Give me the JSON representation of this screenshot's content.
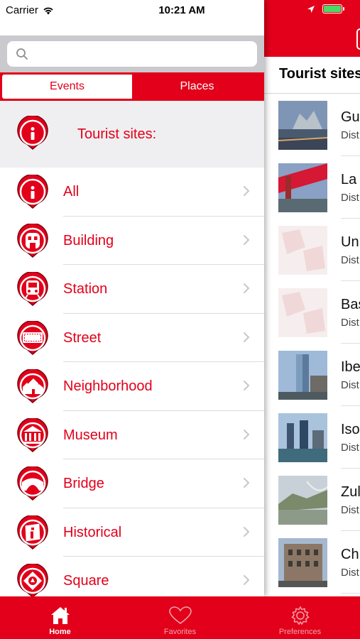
{
  "status_bar": {
    "carrier": "Carrier",
    "time": "10:21 AM"
  },
  "search": {
    "placeholder": "",
    "value": ""
  },
  "segments": [
    {
      "label": "Events",
      "selected": false
    },
    {
      "label": "Places",
      "selected": true
    }
  ],
  "section_header": {
    "title": "Tourist sites:",
    "icon": "info-pin-icon"
  },
  "categories": [
    {
      "label": "All",
      "icon": "info-pin-icon"
    },
    {
      "label": "Building",
      "icon": "building-pin-icon"
    },
    {
      "label": "Station",
      "icon": "train-pin-icon"
    },
    {
      "label": "Street",
      "icon": "street-sign-pin-icon"
    },
    {
      "label": "Neighborhood",
      "icon": "houses-pin-icon"
    },
    {
      "label": "Museum",
      "icon": "museum-pin-icon"
    },
    {
      "label": "Bridge",
      "icon": "bridge-pin-icon"
    },
    {
      "label": "Historical",
      "icon": "historical-pin-icon"
    },
    {
      "label": "Square",
      "icon": "square-pin-icon"
    }
  ],
  "right_panel": {
    "title": "Tourist sites",
    "items": [
      {
        "name": "Gu",
        "distance": "Dist"
      },
      {
        "name": "La",
        "distance": "Dist"
      },
      {
        "name": "Un",
        "distance": "Dist"
      },
      {
        "name": "Bas",
        "distance": "Dist"
      },
      {
        "name": "Ibe",
        "distance": "Dist"
      },
      {
        "name": "Iso",
        "distance": "Dist"
      },
      {
        "name": "Zul",
        "distance": "Dist"
      },
      {
        "name": "Ch",
        "distance": "Dist"
      }
    ]
  },
  "tab_bar": [
    {
      "label": "Home",
      "icon": "home-icon",
      "selected": true
    },
    {
      "label": "Favorites",
      "icon": "heart-icon",
      "selected": false
    },
    {
      "label": "Preferences",
      "icon": "gear-icon",
      "selected": false
    }
  ],
  "colors": {
    "accent": "#e2001a",
    "section_bg": "#efeff1",
    "search_bg": "#c9c9ce"
  }
}
